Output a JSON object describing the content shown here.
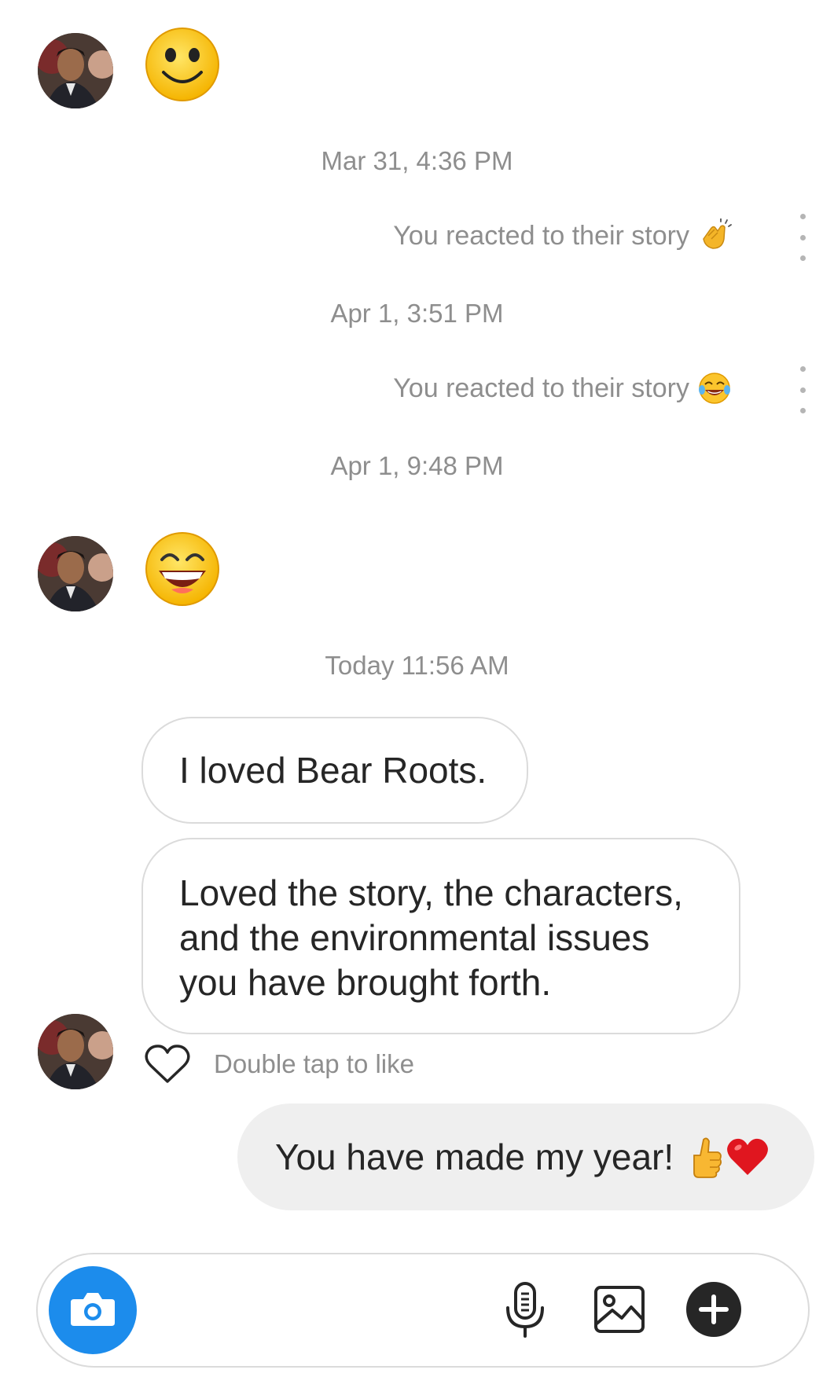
{
  "thread": {
    "timestamps": [
      "Mar 31, 4:36 PM",
      "Apr 1, 3:51 PM",
      "Apr 1, 9:48 PM",
      "Today 11:56 AM"
    ],
    "reactions": [
      {
        "text": "You reacted to their story",
        "emoji": "clapping-hands-emoji"
      },
      {
        "text": "You reacted to their story",
        "emoji": "tears-of-joy-emoji"
      }
    ],
    "incoming_emoji_1": "slightly-smiling-face-emoji",
    "incoming_emoji_2": "grinning-squinting-face-emoji",
    "message_1": "I loved Bear Roots.",
    "message_2_lines": [
      "Loved the story, the characters,",
      "and the environmental issues",
      "you have brought forth."
    ],
    "like_hint": "Double tap to like",
    "outgoing_message": "You have made my year!",
    "outgoing_emojis": [
      "thumbs-up-emoji",
      "red-heart-emoji"
    ]
  },
  "composer": {
    "placeholder": "",
    "icons": [
      "camera-icon",
      "microphone-icon",
      "gallery-icon",
      "plus-icon"
    ]
  },
  "colors": {
    "accent_blue": "#1c8cec",
    "secondary_text": "#8e8e8e",
    "outgoing_bubble": "#efefef",
    "bubble_border": "#dbdbdb"
  }
}
